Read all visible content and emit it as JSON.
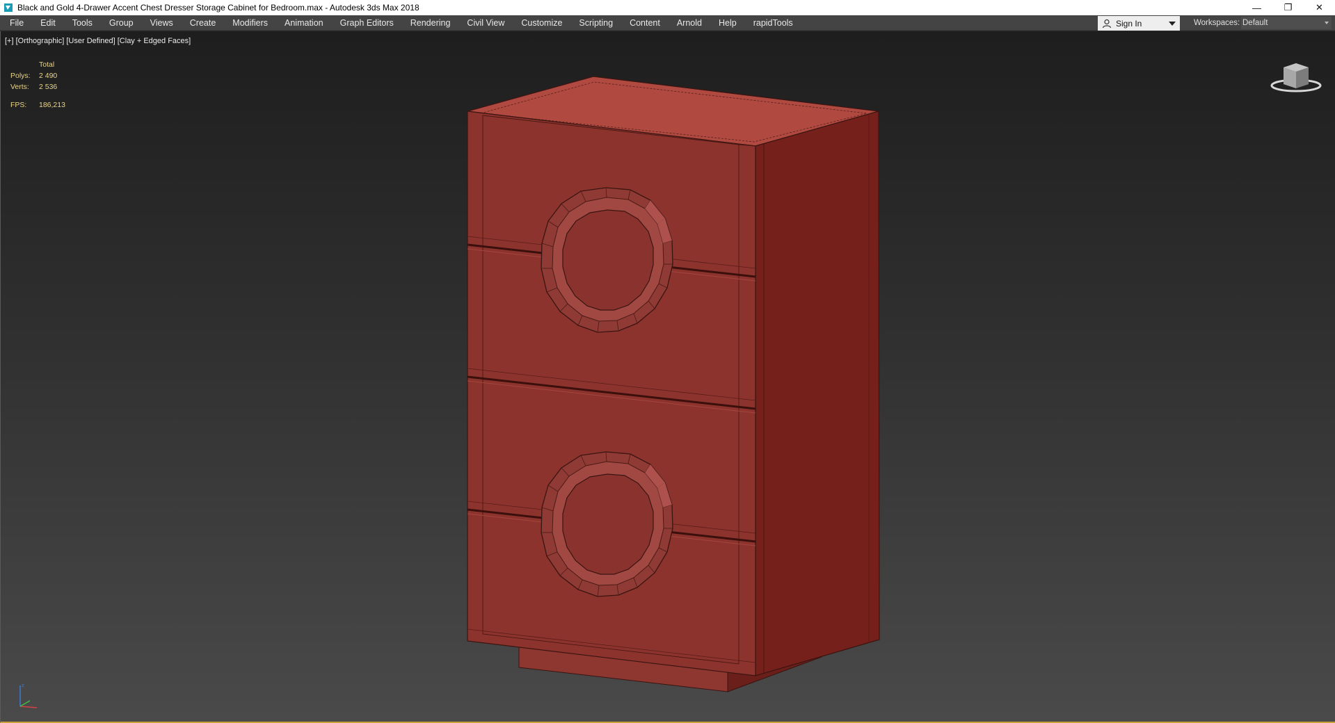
{
  "window": {
    "title": "Black and Gold 4-Drawer Accent Chest Dresser Storage Cabinet for Bedroom.max - Autodesk 3ds Max 2018",
    "controls": {
      "minimize": "—",
      "restore": "❐",
      "close": "✕"
    }
  },
  "menu": {
    "items": [
      "File",
      "Edit",
      "Tools",
      "Group",
      "Views",
      "Create",
      "Modifiers",
      "Animation",
      "Graph Editors",
      "Rendering",
      "Civil View",
      "Customize",
      "Scripting",
      "Content",
      "Arnold",
      "Help",
      "rapidTools"
    ]
  },
  "account": {
    "sign_in": "Sign In",
    "icon": "user-icon"
  },
  "workspaces": {
    "label": "Workspaces:",
    "value": "Default"
  },
  "viewport": {
    "labels": {
      "plus": "[+]",
      "view": "[Orthographic]",
      "mode": "[User Defined]",
      "shading": "[Clay + Edged Faces]"
    },
    "stats": {
      "header": "Total",
      "polys_label": "Polys:",
      "polys_value": "2 490",
      "verts_label": "Verts:",
      "verts_value": "2 536",
      "fps_label": "FPS:",
      "fps_value": "186,213"
    },
    "model_color": "#8b3530"
  }
}
